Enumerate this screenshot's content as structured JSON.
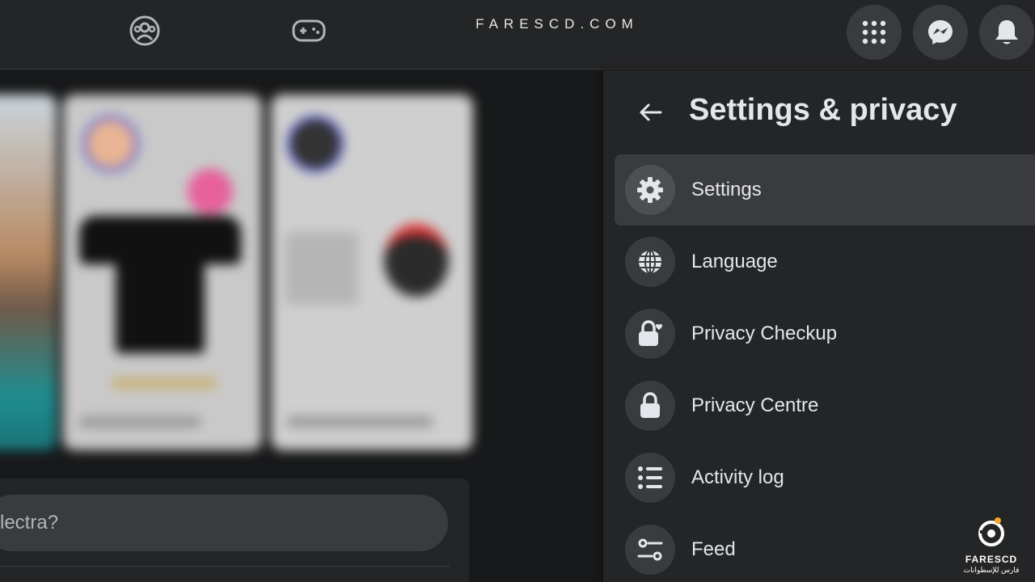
{
  "topbar": {
    "watermark": "FARESCD.COM",
    "icons": [
      "groups-icon",
      "gaming-icon",
      "menu-grid-icon",
      "messenger-icon",
      "notifications-icon"
    ]
  },
  "composer": {
    "placeholder": "lectra?"
  },
  "settings_panel": {
    "title": "Settings & privacy",
    "items": [
      {
        "label": "Settings",
        "icon": "gear-icon",
        "active": true
      },
      {
        "label": "Language",
        "icon": "globe-icon",
        "active": false
      },
      {
        "label": "Privacy Checkup",
        "icon": "lock-heart-icon",
        "active": false
      },
      {
        "label": "Privacy Centre",
        "icon": "lock-icon",
        "active": false
      },
      {
        "label": "Activity log",
        "icon": "list-icon",
        "active": false
      },
      {
        "label": "Feed",
        "icon": "sliders-icon",
        "active": false
      }
    ]
  },
  "logo": {
    "brand": "FARESCD",
    "subtitle": "فارس للإسطوانات"
  },
  "colors": {
    "background": "#18191a",
    "surface": "#242526",
    "hover": "#3a3b3c",
    "text": "#e4e6eb"
  }
}
